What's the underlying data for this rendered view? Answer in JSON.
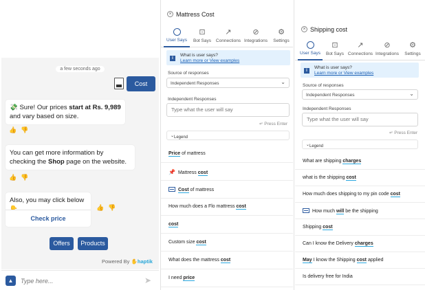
{
  "chat": {
    "timestamp": "a few seconds ago",
    "user_message": "Cost",
    "bot1_prefix": "💸 Sure! Our prices ",
    "bot1_bold": "start at Rs. 9,989",
    "bot1_suffix": " and vary based on size.",
    "bot2_prefix": "You can get more information by checking the ",
    "bot2_bold": "Shop",
    "bot2_suffix": " page on the website.",
    "bot3_text": "Also, you may click below 👇",
    "check_price_label": "Check price",
    "quick_replies": [
      "Offers",
      "Products"
    ],
    "powered_by": "Powered By",
    "brand": "haptik",
    "input_placeholder": "Type here..."
  },
  "tabs": [
    "User Says",
    "Bot Says",
    "Connections",
    "Integrations",
    "Settings"
  ],
  "panel1": {
    "title": "Mattress Cost",
    "info_question": "What is user says?",
    "info_link": "Learn more or View examples",
    "source_label": "Source of responses",
    "source_value": "Independent Responses",
    "independent_label": "Independent Responses",
    "input_placeholder": "Type what the user will say",
    "press_enter": "↵ Press Enter",
    "legend": "Legend",
    "rows": [
      {
        "icon": "",
        "parts": [
          {
            "t": "Price",
            "e": true
          },
          {
            "t": " of mattress",
            "e": false
          }
        ]
      },
      {
        "icon": "pin-icon",
        "parts": [
          {
            "t": "Mattress ",
            "e": false
          },
          {
            "t": "cost",
            "e": true
          }
        ]
      },
      {
        "icon": "tag-icon",
        "parts": [
          {
            "t": "Cost",
            "e": true
          },
          {
            "t": " of mattress",
            "e": false
          }
        ]
      },
      {
        "icon": "",
        "parts": [
          {
            "t": "How much does a Flo mattress ",
            "e": false
          },
          {
            "t": "cost",
            "e": true
          }
        ]
      },
      {
        "icon": "",
        "parts": [
          {
            "t": "cost",
            "e": true
          }
        ]
      },
      {
        "icon": "",
        "parts": [
          {
            "t": "Custom size ",
            "e": false
          },
          {
            "t": "cost",
            "e": true
          }
        ]
      },
      {
        "icon": "",
        "parts": [
          {
            "t": "What does the mattress ",
            "e": false
          },
          {
            "t": "cost",
            "e": true
          }
        ]
      },
      {
        "icon": "",
        "parts": [
          {
            "t": "I need ",
            "e": false
          },
          {
            "t": "price",
            "e": true
          }
        ]
      }
    ]
  },
  "panel2": {
    "title": "Shipping cost",
    "info_question": "What is user says?",
    "info_link": "Learn more or View examples",
    "source_label": "Source of responses",
    "source_value": "Independent Responses",
    "independent_label": "Independent Responses",
    "input_placeholder": "Type what the user will say",
    "press_enter": "↵ Press Enter",
    "legend": "Legend",
    "rows": [
      {
        "icon": "",
        "parts": [
          {
            "t": "What are shipping ",
            "e": false
          },
          {
            "t": "charges",
            "e": true
          }
        ]
      },
      {
        "icon": "",
        "parts": [
          {
            "t": "what is the shipping ",
            "e": false
          },
          {
            "t": "cost",
            "e": true
          }
        ]
      },
      {
        "icon": "",
        "parts": [
          {
            "t": "How much does shipping to my pin code ",
            "e": false
          },
          {
            "t": "cost",
            "e": true
          }
        ]
      },
      {
        "icon": "tag-icon",
        "parts": [
          {
            "t": "How much ",
            "e": false
          },
          {
            "t": "will",
            "e": true
          },
          {
            "t": " be the shipping",
            "e": false
          }
        ]
      },
      {
        "icon": "",
        "parts": [
          {
            "t": "Shipping ",
            "e": false
          },
          {
            "t": "cost",
            "e": true
          }
        ]
      },
      {
        "icon": "",
        "parts": [
          {
            "t": "Can I know the Delivery ",
            "e": false
          },
          {
            "t": "charges",
            "e": true
          }
        ]
      },
      {
        "icon": "",
        "parts": [
          {
            "t": "May",
            "e": true
          },
          {
            "t": " I know the Shipping ",
            "e": false
          },
          {
            "t": "cost",
            "e": true
          },
          {
            "t": " applied",
            "e": false
          }
        ]
      },
      {
        "icon": "",
        "parts": [
          {
            "t": "Is delivery free for India",
            "e": false
          }
        ]
      }
    ]
  },
  "colors": {
    "accent": "#2b5a9f",
    "entity_underline": "#29a7df",
    "info_bg": "#e3f1fd"
  }
}
